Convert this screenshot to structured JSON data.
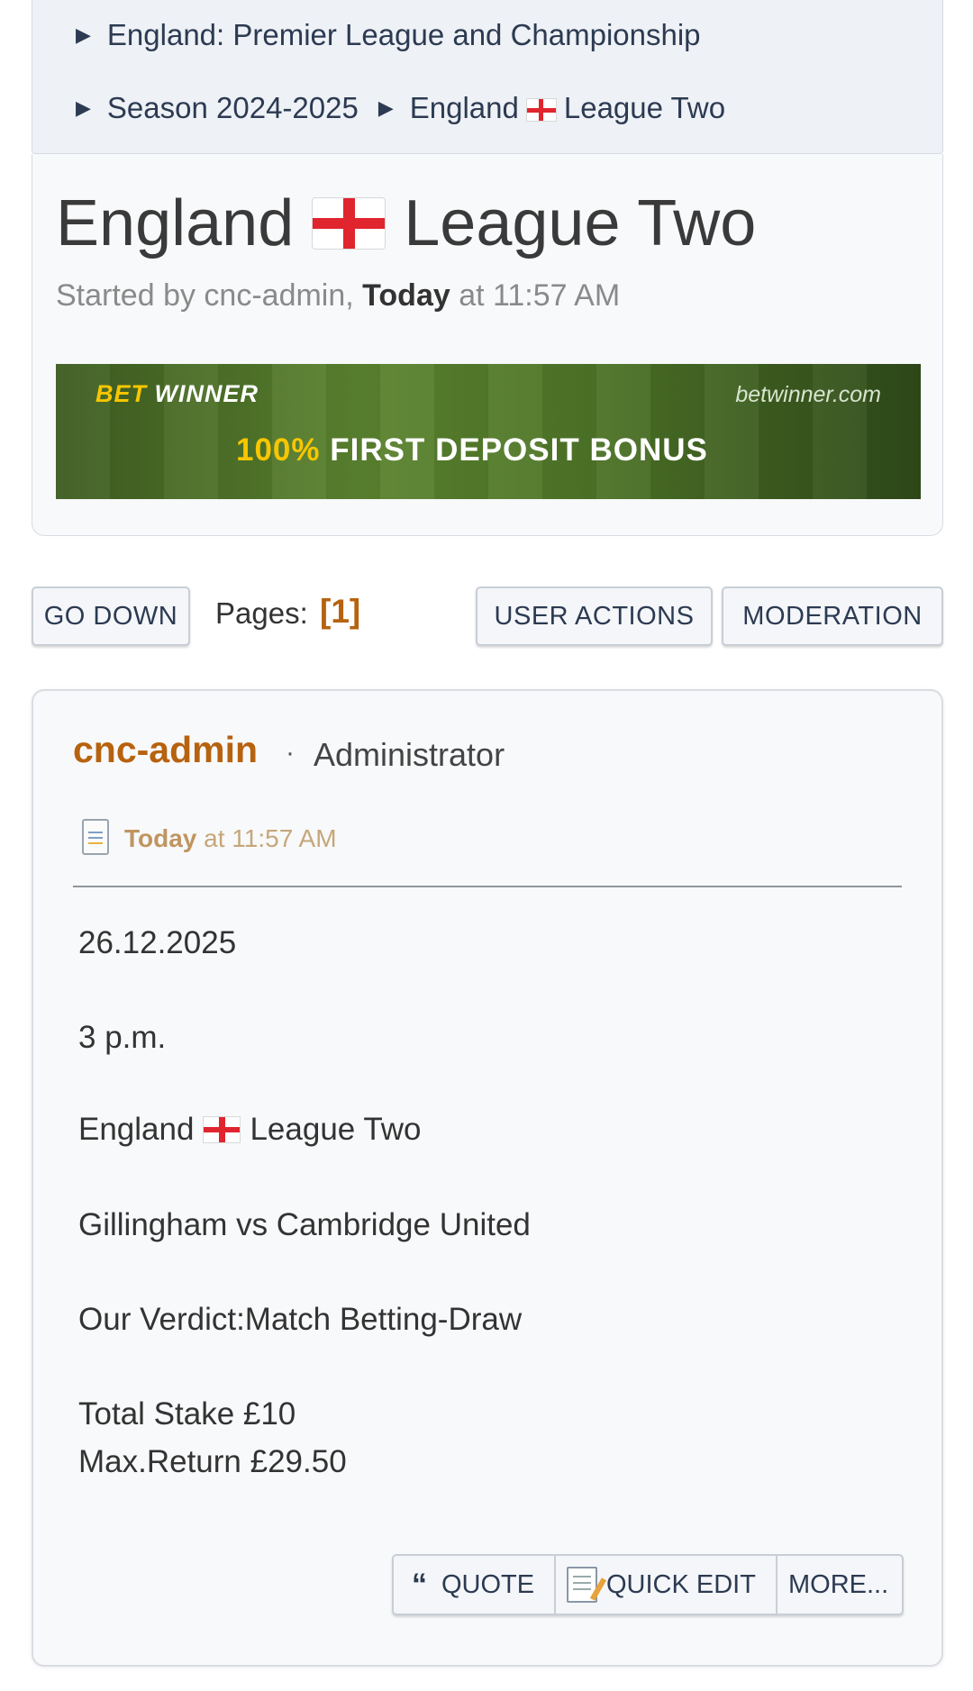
{
  "breadcrumb": {
    "line1": "England: Premier League and Championship",
    "line2a": "Season 2024-2025",
    "line2b_pre": "England",
    "line2b_post": "League Two"
  },
  "topic": {
    "title_pre": "England",
    "title_post": "League Two",
    "started_prefix": "Started by cnc-admin, ",
    "started_day": "Today",
    "started_time": " at 11:57 AM"
  },
  "banner": {
    "brand_bet": "BET",
    "brand_winner": "WINNER",
    "url": "betwinner.com",
    "offer_pct": "100%",
    "offer_text": "FIRST DEPOSIT BONUS"
  },
  "toolbar": {
    "go_down": "GO DOWN",
    "pages_label": "Pages:",
    "current_page": "[1]",
    "user_actions": "USER ACTIONS",
    "moderation": "MODERATION"
  },
  "post": {
    "author": "cnc-admin",
    "separator": "·",
    "role": "Administrator",
    "time_day": "Today",
    "time_rest": " at 11:57 AM",
    "date": "26.12.2025",
    "time": "3 p.m.",
    "league_pre": "England",
    "league_post": "League Two",
    "match": "Gillingham vs Cambridge United",
    "verdict": "Our Verdict:Match Betting-Draw",
    "stake": "Total Stake £10",
    "max_return": "Max.Return  £29.50"
  },
  "post_actions": {
    "quote": "QUOTE",
    "quick_edit": "QUICK EDIT",
    "more": "MORE..."
  },
  "icons": [
    "triangle-right-icon",
    "england-flag-icon",
    "document-icon",
    "quote-icon",
    "edit-icon"
  ]
}
